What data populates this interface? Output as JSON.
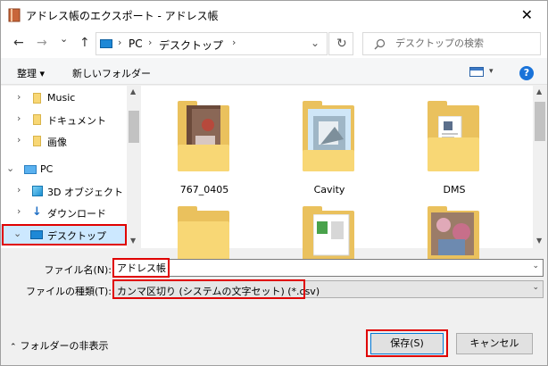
{
  "window": {
    "title": "アドレス帳のエクスポート - アドレス帳",
    "close_glyph": "✕"
  },
  "nav": {
    "back_glyph": "←",
    "forward_glyph": "→",
    "recent_glyph": "⌄",
    "up_glyph": "↑",
    "breadcrumb": [
      "PC",
      "デスクトップ"
    ],
    "address_dropdown_glyph": "⌄",
    "refresh_glyph": "↻",
    "search": {
      "placeholder": "デスクトップの検索",
      "icon": "search-icon"
    }
  },
  "toolbar": {
    "organize": "整理 ▾",
    "new_folder": "新しいフォルダー",
    "help": "?"
  },
  "tree": [
    {
      "label": "Music",
      "icon": "folder-icon",
      "expander": "›",
      "level": 1
    },
    {
      "label": "ドキュメント",
      "icon": "folder-icon",
      "expander": "›",
      "level": 1
    },
    {
      "label": "画像",
      "icon": "folder-icon",
      "expander": "›",
      "level": 1
    },
    {
      "label": "PC",
      "icon": "pc-icon",
      "expander": "⌄",
      "level": 0
    },
    {
      "label": "3D オブジェクト",
      "icon": "cube-icon",
      "expander": "›",
      "level": 1
    },
    {
      "label": "ダウンロード",
      "icon": "download-icon",
      "expander": "›",
      "level": 1
    },
    {
      "label": "デスクトップ",
      "icon": "desktop-icon",
      "expander": "⌄",
      "level": 1,
      "selected": true
    }
  ],
  "files": [
    {
      "name": "767_0405"
    },
    {
      "name": "Cavity"
    },
    {
      "name": "DMS"
    },
    {
      "name": ""
    },
    {
      "name": ""
    },
    {
      "name": ""
    }
  ],
  "form": {
    "filename_label": "ファイル名(N):",
    "filename_value": "アドレス帳",
    "filetype_label": "ファイルの種類(T):",
    "filetype_value": "カンマ区切り (システムの文字セット) (*.csv)",
    "dropdown_glyph": "⌄"
  },
  "footer": {
    "hide_folders": "フォルダーの非表示",
    "hide_chevron": "⌃",
    "save": "保存(S)",
    "cancel": "キャンセル"
  },
  "colors": {
    "accent": "#0078d7",
    "highlight_red": "#e00000",
    "folder_yellow": "#f8d775",
    "selection": "#cce8ff"
  }
}
